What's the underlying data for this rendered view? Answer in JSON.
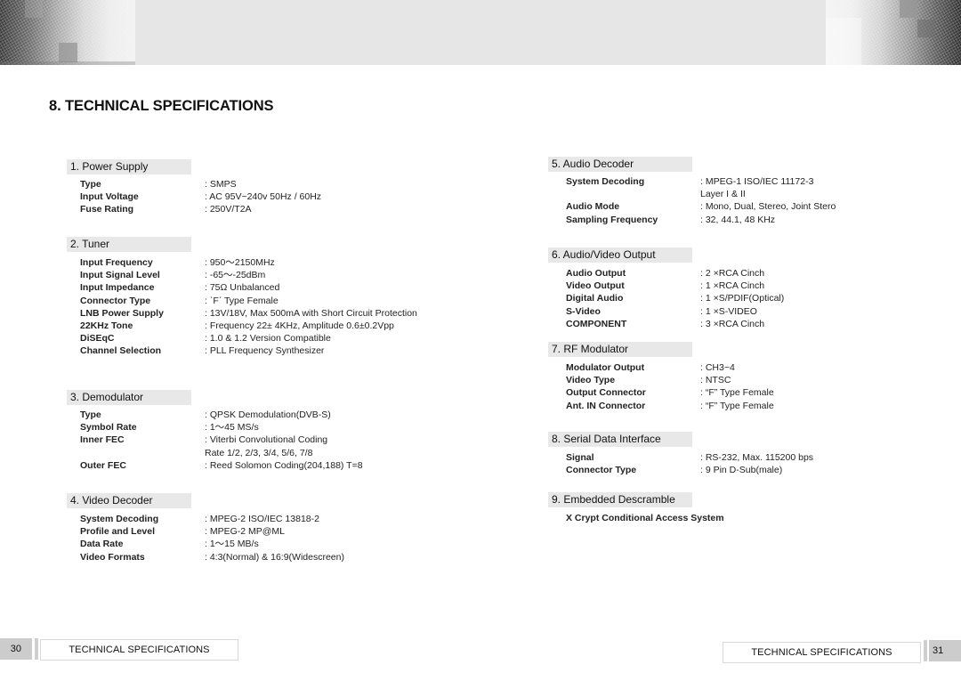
{
  "page_title": "8. TECHNICAL SPECIFICATIONS",
  "left_column": [
    {
      "heading": "1. Power Supply",
      "rows": [
        {
          "label": "Type",
          "value": ":  SMPS"
        },
        {
          "label": "Input Voltage",
          "value": ":  AC 95V~240v 50Hz / 60Hz"
        },
        {
          "label": "Fuse Rating",
          "value": ":  250V/T2A"
        }
      ]
    },
    {
      "heading": "2. Tuner",
      "rows": [
        {
          "label": "Input Frequency",
          "value": ":  950～2150MHz"
        },
        {
          "label": "Input Signal Level",
          "value": ":  -65～-25dBm"
        },
        {
          "label": "Input Impedance",
          "value": ":  75Ω  Unbalanced"
        },
        {
          "label": "Connector Type",
          "value": ":  ˋFˊ Type Female"
        },
        {
          "label": "LNB Power Supply",
          "value": ":  13V/18V, Max 500mA with Short Circuit Protection"
        },
        {
          "label": "22KHz Tone",
          "value": ":  Frequency 22± 4KHz, Amplitude 0.6±0.2Vpp"
        },
        {
          "label": "DiSEqC",
          "value": ":  1.0 & 1.2 Version Compatible"
        },
        {
          "label": "Channel Selection",
          "value": ":  PLL Frequency Synthesizer"
        }
      ]
    },
    {
      "heading": "3. Demodulator",
      "rows": [
        {
          "label": "Type",
          "value": ":  QPSK Demodulation(DVB-S)"
        },
        {
          "label": "Symbol Rate",
          "value": ":  1～45 MS/s"
        },
        {
          "label": "Inner FEC",
          "value": ":  Viterbi Convolutional Coding"
        },
        {
          "label": "",
          "value": "   Rate  1/2, 2/3, 3/4, 5/6, 7/8"
        },
        {
          "label": "Outer FEC",
          "value": ":  Reed Solomon Coding(204,188) T=8"
        }
      ]
    },
    {
      "heading": "4. Video Decoder",
      "rows": [
        {
          "label": "System Decoding",
          "value": ":  MPEG-2 ISO/IEC 13818-2"
        },
        {
          "label": "Profile and Level",
          "value": ":  MPEG-2 MP@ML"
        },
        {
          "label": "Data Rate",
          "value": ":  1～15 MB/s"
        },
        {
          "label": "Video Formats",
          "value": ":  4:3(Normal) & 16:9(Widescreen)"
        }
      ]
    }
  ],
  "right_column": [
    {
      "heading": "5. Audio Decoder",
      "rows": [
        {
          "label": "System Decoding",
          "value": ": MPEG-1 ISO/IEC 11172-3"
        },
        {
          "label": "",
          "value": "  Layer I & II"
        },
        {
          "label": "Audio Mode",
          "value": ": Mono, Dual, Stereo, Joint Stero"
        },
        {
          "label": "Sampling Frequency",
          "value": ": 32, 44.1, 48 KHz"
        }
      ]
    },
    {
      "heading": "6. Audio/Video Output",
      "rows": [
        {
          "label": "Audio Output",
          "value": ": 2 ×RCA Cinch"
        },
        {
          "label": "Video Output",
          "value": ": 1 ×RCA Cinch"
        },
        {
          "label": "Digital Audio",
          "value": ": 1 ×S/PDIF(Optical)"
        },
        {
          "label": "S-Video",
          "value": ": 1 ×S-VIDEO"
        },
        {
          "label": "COMPONENT",
          "value": ": 3 ×RCA Cinch"
        }
      ]
    },
    {
      "heading": "7.  RF Modulator",
      "rows": [
        {
          "label": "Modulator Output",
          "value": ": CH3~4"
        },
        {
          "label": "Video Type",
          "value": ": NTSC"
        },
        {
          "label": "Output Connector",
          "value": ": “F” Type Female"
        },
        {
          "label": "Ant. IN Connector",
          "value": ": “F” Type Female"
        }
      ]
    },
    {
      "heading": "8. Serial Data Interface",
      "rows": [
        {
          "label": "Signal",
          "value": ": RS-232, Max. 115200 bps"
        },
        {
          "label": "Connector Type",
          "value": ": 9 Pin D-Sub(male)"
        }
      ]
    },
    {
      "heading": "9. Embedded Descramble",
      "rows": [
        {
          "label": "X Crypt Conditional Access System",
          "value": ""
        }
      ]
    }
  ],
  "footer": {
    "left_page_number": "30",
    "left_label": "TECHNICAL SPECIFICATIONS",
    "right_label": "TECHNICAL SPECIFICATIONS",
    "right_page_number": "31"
  }
}
